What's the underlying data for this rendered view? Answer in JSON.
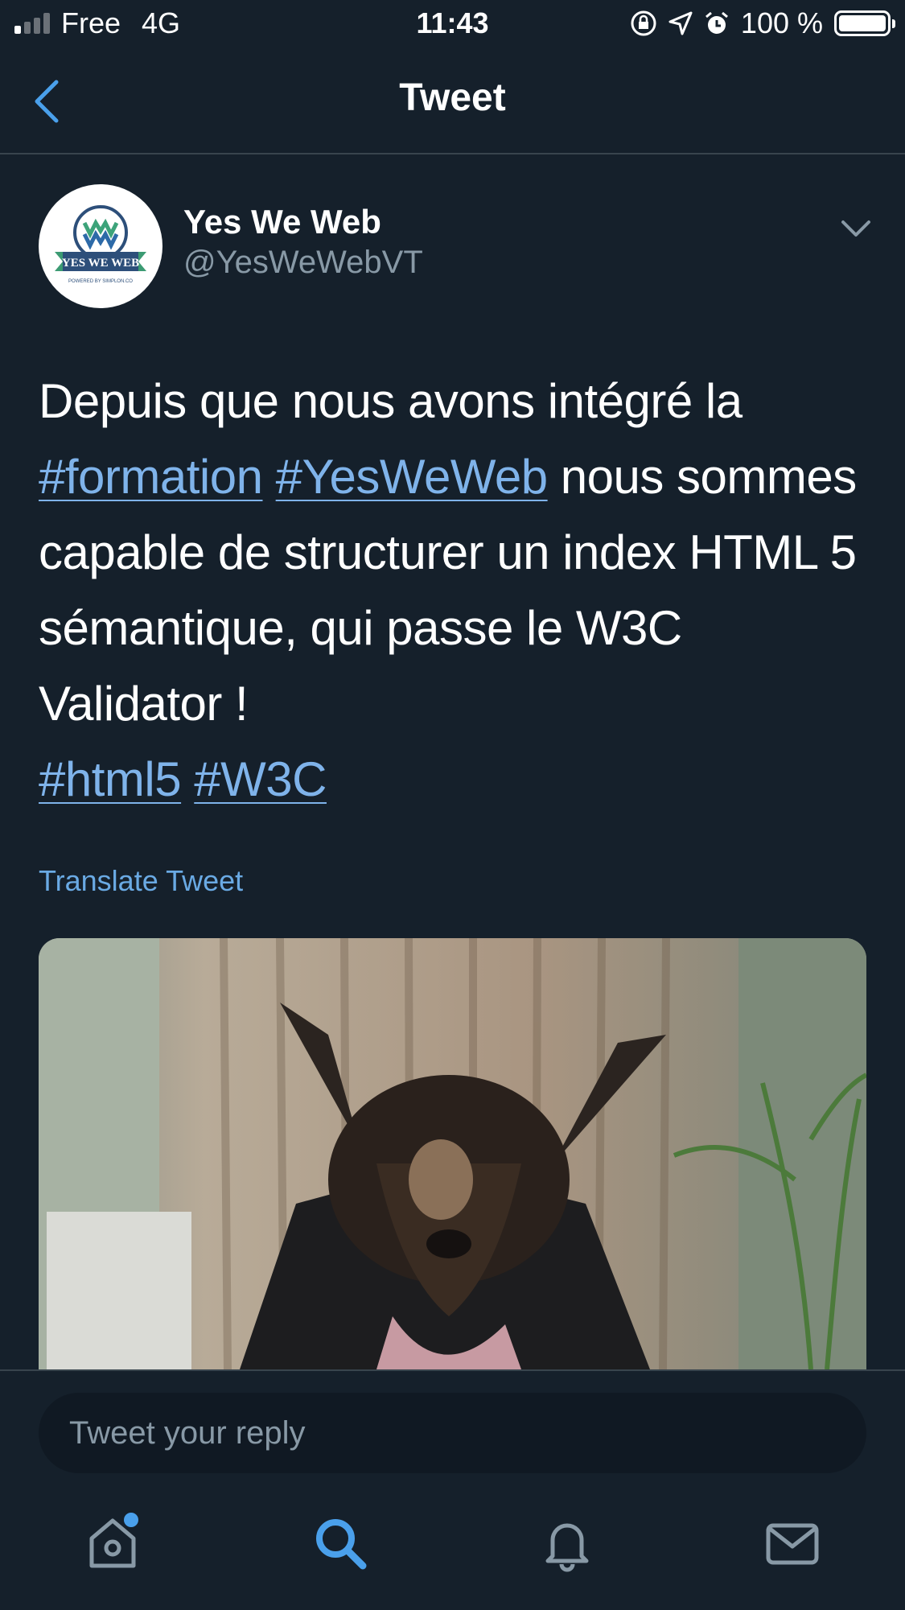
{
  "status_bar": {
    "carrier": "Free",
    "network": "4G",
    "time": "11:43",
    "battery": "100 %",
    "icons": [
      "orientation-lock-icon",
      "location-icon",
      "alarm-icon",
      "battery-icon"
    ]
  },
  "nav": {
    "title": "Tweet",
    "back_icon": "chevron-left-icon"
  },
  "tweet": {
    "author_name": "Yes We Web",
    "author_handle": "@YesWeWebVT",
    "avatar_text": "YES WE WEB",
    "avatar_sub": "POWERED BY SIMPLON.CO",
    "menu_icon": "chevron-down-icon",
    "text": {
      "line1": "Depuis que nous avons intégré la",
      "tag1": "#formation",
      "tag2": "#YesWeWeb",
      "after_tags": "nous sommes capable de structurer un index HTML 5 sémantique, qui passe le W3C Validator !",
      "tag3": "#html5",
      "tag4": "#W3C"
    },
    "translate": "Translate Tweet"
  },
  "reply": {
    "placeholder": "Tweet your reply"
  },
  "tabbar": {
    "items": [
      "home-icon",
      "search-icon",
      "notifications-icon",
      "messages-icon"
    ],
    "active": "search-icon",
    "has_notification_dot": true
  },
  "colors": {
    "background": "#15202b",
    "link": "#7fb3ea",
    "secondary_text": "#8899a6",
    "accent": "#4aa0eb",
    "divider": "#38444d"
  }
}
